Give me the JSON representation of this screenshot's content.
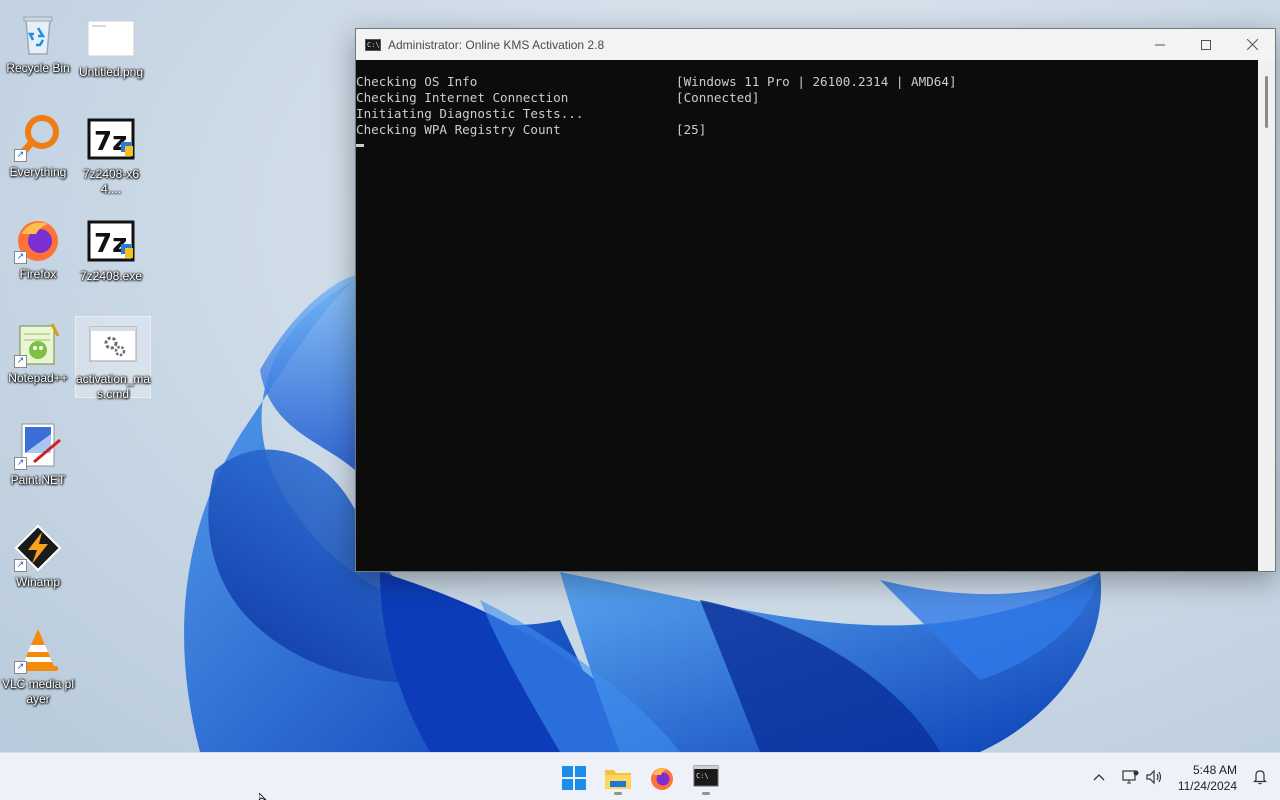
{
  "desktop": {
    "icons": [
      {
        "label": "Recycle Bin",
        "icon": "recycle-bin-icon"
      },
      {
        "label": "Untitled.png",
        "icon": "image-file-icon"
      },
      {
        "label": "Everything",
        "icon": "everything-search-icon"
      },
      {
        "label": "7z2408-x64....",
        "icon": "7zip-installer-icon"
      },
      {
        "label": "Firefox",
        "icon": "firefox-icon"
      },
      {
        "label": "7z2408.exe",
        "icon": "7zip-installer-icon"
      },
      {
        "label": "Notepad++",
        "icon": "notepadpp-icon"
      },
      {
        "label": "activation_mas.cmd",
        "icon": "cmd-file-icon"
      },
      {
        "label": "Paint.NET",
        "icon": "paintnet-icon"
      },
      {
        "label": "Winamp",
        "icon": "winamp-icon"
      },
      {
        "label": "VLC media player",
        "icon": "vlc-icon"
      }
    ]
  },
  "console": {
    "title_prefix": "Administrator:",
    "title": "Online KMS Activation 2.8",
    "lines": [
      {
        "key": "Checking OS Info",
        "value": "[Windows 11 Pro | 26100.2314 | AMD64]"
      },
      {
        "key": "Checking Internet Connection",
        "value": "[Connected]"
      },
      {
        "key": "Initiating Diagnostic Tests...",
        "value": ""
      },
      {
        "key": "Checking WPA Registry Count",
        "value": "[25]"
      }
    ],
    "buttons": {
      "minimize": "minimize-icon",
      "maximize": "maximize-icon",
      "close": "close-icon"
    }
  },
  "taskbar": {
    "apps": [
      {
        "name": "Start",
        "icon": "windows-start-icon"
      },
      {
        "name": "File Explorer",
        "icon": "file-explorer-icon"
      },
      {
        "name": "Firefox",
        "icon": "firefox-icon"
      },
      {
        "name": "Command Prompt",
        "icon": "terminal-icon"
      }
    ],
    "tray": {
      "time": "5:48 AM",
      "date": "11/24/2024"
    }
  },
  "colors": {
    "console_bg": "#0c0c0c",
    "console_text": "#cccccc",
    "accent_blue": "#1a5fd6",
    "taskbar_bg": "#eef2f8"
  }
}
